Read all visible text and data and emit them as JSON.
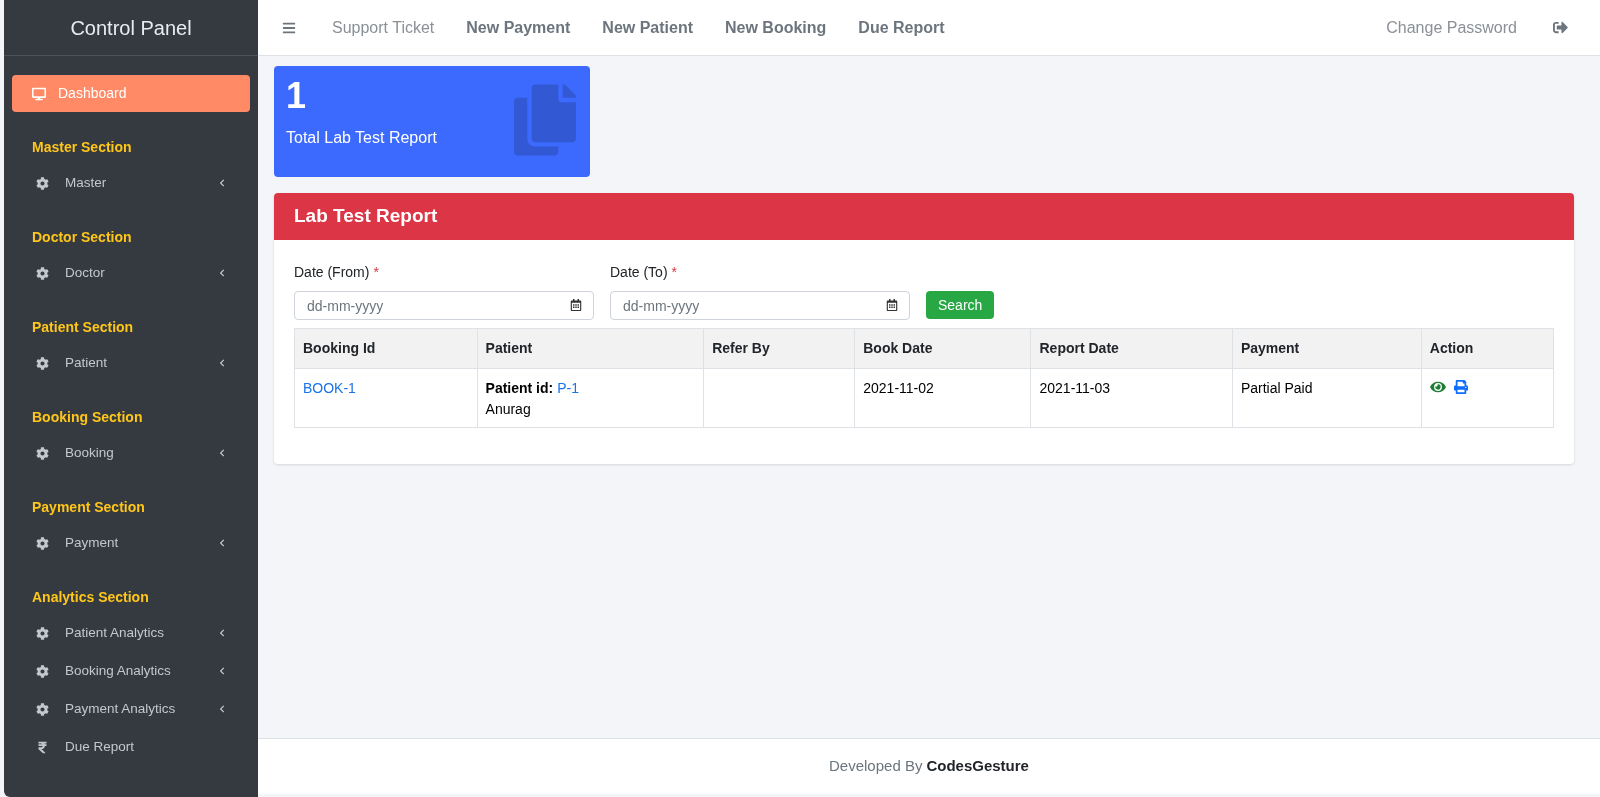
{
  "sidebar": {
    "title": "Control Panel",
    "active_item": {
      "label": "Dashboard",
      "selected": true
    },
    "sections": [
      {
        "title": "Master Section",
        "items": [
          {
            "label": "Master",
            "kind": "settings",
            "has_submenu": true
          }
        ]
      },
      {
        "title": "Doctor Section",
        "items": [
          {
            "label": "Doctor",
            "kind": "settings",
            "has_submenu": true
          }
        ]
      },
      {
        "title": "Patient Section",
        "items": [
          {
            "label": "Patient",
            "kind": "settings",
            "has_submenu": true
          }
        ]
      },
      {
        "title": "Booking Section",
        "items": [
          {
            "label": "Booking",
            "kind": "settings",
            "has_submenu": true
          }
        ]
      },
      {
        "title": "Payment Section",
        "items": [
          {
            "label": "Payment",
            "kind": "settings",
            "has_submenu": true
          }
        ]
      },
      {
        "title": "Analytics Section",
        "items": [
          {
            "label": "Patient Analytics",
            "kind": "settings",
            "has_submenu": true
          },
          {
            "label": "Booking Analytics",
            "kind": "settings",
            "has_submenu": true
          },
          {
            "label": "Payment Analytics",
            "kind": "settings",
            "has_submenu": true
          },
          {
            "label": "Due Report",
            "kind": "money",
            "has_submenu": false
          }
        ]
      }
    ]
  },
  "topbar": {
    "links": [
      {
        "label": "Support Ticket",
        "emphasized": false
      },
      {
        "label": "New Payment",
        "emphasized": true
      },
      {
        "label": "New Patient",
        "emphasized": true
      },
      {
        "label": "New Booking",
        "emphasized": true
      },
      {
        "label": "Due Report",
        "emphasized": true
      }
    ],
    "right_link": "Change Password"
  },
  "stat_card": {
    "value": "1",
    "label": "Total Lab Test Report"
  },
  "report": {
    "title": "Lab Test Report",
    "filters": [
      {
        "label": "Date (From)",
        "required_mark": "*",
        "placeholder": "dd-mm-yyyy"
      },
      {
        "label": "Date (To)",
        "required_mark": "*",
        "placeholder": "dd-mm-yyyy"
      }
    ],
    "search_button": "Search",
    "columns": [
      "Booking Id",
      "Patient",
      "Refer By",
      "Book Date",
      "Report Date",
      "Payment",
      "Action"
    ],
    "rows": [
      {
        "booking_id": "BOOK-1",
        "patient_label": "Patient id:",
        "patient_id": "P-1",
        "patient_name": "Anurag",
        "book_date": "2021-11-02",
        "report_date": "2021-11-03",
        "payment": "Partial Paid"
      }
    ]
  },
  "footer": {
    "prefix": "Developed By",
    "brand": "CodesGesture"
  }
}
